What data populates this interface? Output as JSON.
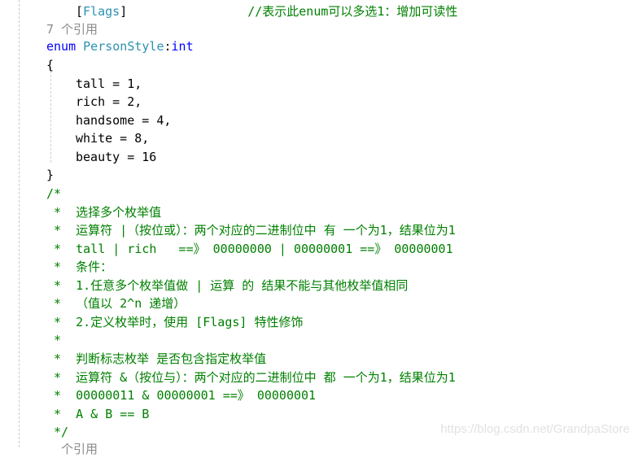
{
  "code": {
    "attribute_line": {
      "open_bracket": "[",
      "attribute": "Flags",
      "close_bracket": "]",
      "comment": "//表示此enum可以多选1：增加可读性"
    },
    "codelens_references": "7 个引用",
    "enum_decl": {
      "keyword": "enum",
      "name": "PersonStyle",
      "colon": ":",
      "base_type": "int"
    },
    "open_brace": "{",
    "members": [
      "tall = 1,",
      "rich = 2,",
      "handsome = 4,",
      "white = 8,",
      "beauty = 16"
    ],
    "close_brace": "}",
    "comment_block": [
      "/*",
      " *  选择多个枚举值",
      " *  运算符 |（按位或）：两个对应的二进制位中 有 一个为1，结果位为1",
      " *  tall | rich   ==》 00000000 | 00000001 ==》 00000001",
      " *  条件：",
      " *  1.任意多个枚举值做 | 运算 的 结果不能与其他枚举值相同",
      " *  （值以 2^n 递增）",
      " *  2.定义枚举时，使用 [Flags] 特性修饰",
      " *",
      " *  判断标志枚举 是否包含指定枚举值",
      " *  运算符 &（按位与）：两个对应的二进制位中 都 一个为1，结果位为1",
      " *  00000011 & 00000001 ==》 00000001",
      " *  A & B == B",
      " */"
    ],
    "trailing_codelens_partial": "个引用"
  },
  "watermark": "https://blog.csdn.net/GrandpaStore",
  "colors": {
    "keyword": "#0000ff",
    "type": "#2b91af",
    "comment": "#008000",
    "codelens": "#8a8a8a",
    "text": "#000000"
  }
}
